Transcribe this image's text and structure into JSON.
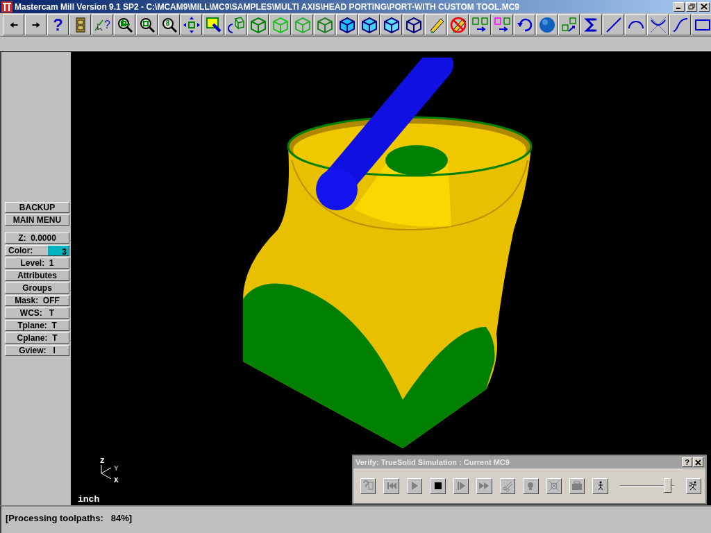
{
  "window": {
    "title": "Mastercam Mill Version 9.1 SP2 - C:\\MCAM9\\MILL\\MC9\\SAMPLES\\MULTI AXIS\\HEAD PORTING\\PORT-WITH CUSTOM TOOL.MC9"
  },
  "toolbar": [
    {
      "kind": "back"
    },
    {
      "kind": "forward"
    },
    {
      "kind": "help",
      "glyph": "?"
    },
    {
      "kind": "cabinet"
    },
    {
      "kind": "analyze",
      "glyph": "?"
    },
    {
      "kind": "zoom-window"
    },
    {
      "kind": "unzoom"
    },
    {
      "kind": "zoom-eight",
      "glyph": "8"
    },
    {
      "kind": "pan"
    },
    {
      "kind": "paint"
    },
    {
      "kind": "rotate"
    },
    {
      "kind": "cube-dark"
    },
    {
      "kind": "cube-light"
    },
    {
      "kind": "cube-pale"
    },
    {
      "kind": "cube-mid"
    },
    {
      "kind": "solid-cube-top"
    },
    {
      "kind": "solid-cube-front"
    },
    {
      "kind": "solid-cube-side"
    },
    {
      "kind": "cube-blue"
    },
    {
      "kind": "pencil"
    },
    {
      "kind": "no-pencil"
    },
    {
      "kind": "translate"
    },
    {
      "kind": "translate-copy"
    },
    {
      "kind": "undo"
    },
    {
      "kind": "sphere"
    },
    {
      "kind": "cubes"
    },
    {
      "kind": "sigma"
    },
    {
      "kind": "line"
    },
    {
      "kind": "arc"
    },
    {
      "kind": "fillet"
    },
    {
      "kind": "spline"
    },
    {
      "kind": "rectangle"
    }
  ],
  "side_menu": [
    {
      "kind": "button",
      "label": "BACKUP"
    },
    {
      "kind": "button",
      "label": "MAIN MENU"
    },
    {
      "kind": "gap"
    },
    {
      "kind": "button",
      "label": "Z:  0.0000"
    },
    {
      "kind": "color",
      "label": "Color:",
      "value": "3",
      "color": "#00b4c0"
    },
    {
      "kind": "button",
      "label": "Level:  1"
    },
    {
      "kind": "button",
      "label": "Attributes"
    },
    {
      "kind": "button",
      "label": "Groups"
    },
    {
      "kind": "button",
      "label": "Mask:  OFF"
    },
    {
      "kind": "button",
      "label": "WCS:   T"
    },
    {
      "kind": "button",
      "label": "Tplane:  T"
    },
    {
      "kind": "button",
      "label": "Cplane:  T"
    },
    {
      "kind": "button",
      "label": "Gview:   I"
    }
  ],
  "viewport": {
    "axes": [
      "Z",
      "Y",
      "X"
    ],
    "units": "inch"
  },
  "verify_dialog": {
    "title": "Verify: TrueSolid Simulation : Current MC9",
    "help_glyph": "?",
    "controls": [
      {
        "kind": "options"
      },
      {
        "kind": "restart"
      },
      {
        "kind": "play"
      },
      {
        "kind": "stop",
        "active": true
      },
      {
        "kind": "step"
      },
      {
        "kind": "fast-forward"
      },
      {
        "kind": "cut"
      },
      {
        "kind": "light"
      },
      {
        "kind": "collision"
      },
      {
        "kind": "save"
      },
      {
        "kind": "walk"
      }
    ],
    "speed": {
      "level": 0.95
    }
  },
  "status_bar": {
    "text": "[Processing toolpaths:   84%]"
  }
}
